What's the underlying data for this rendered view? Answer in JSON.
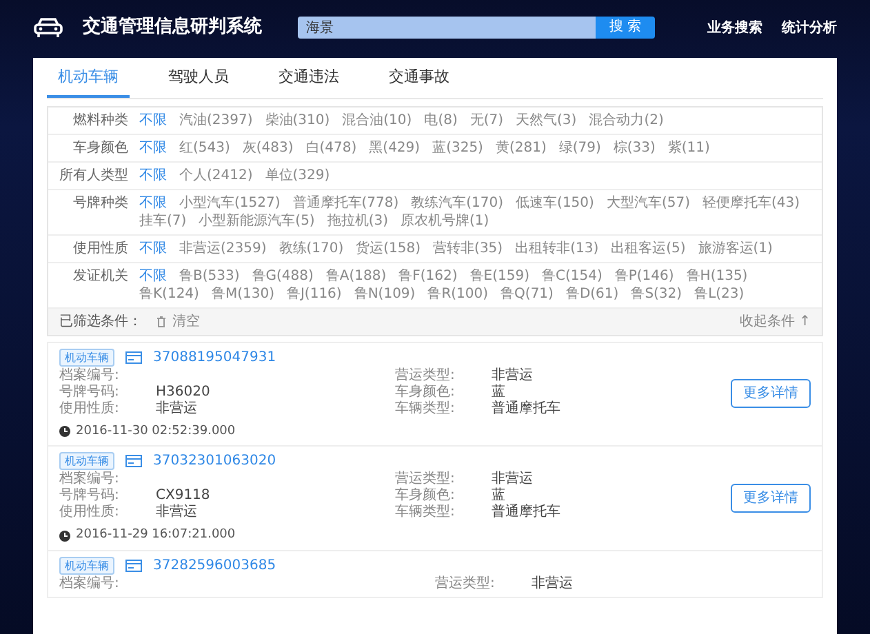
{
  "header": {
    "title": "交通管理信息研判系统",
    "search": {
      "value": "海景",
      "button": "搜 索"
    },
    "nav": [
      "业务搜索",
      "统计分析"
    ]
  },
  "tabs": [
    {
      "label": "机动车辆",
      "selected": true
    },
    {
      "label": "驾驶人员",
      "selected": false
    },
    {
      "label": "交通违法",
      "selected": false
    },
    {
      "label": "交通事故",
      "selected": false
    }
  ],
  "filters": [
    {
      "label": "燃料种类",
      "options": [
        {
          "text": "不限",
          "selected": true
        },
        {
          "text": "汽油(2397)",
          "selected": false
        },
        {
          "text": "柴油(310)",
          "selected": false
        },
        {
          "text": "混合油(10)",
          "selected": false
        },
        {
          "text": "电(8)",
          "selected": false
        },
        {
          "text": "无(7)",
          "selected": false
        },
        {
          "text": "天然气(3)",
          "selected": false
        },
        {
          "text": "混合动力(2)",
          "selected": false
        }
      ]
    },
    {
      "label": "车身颜色",
      "options": [
        {
          "text": "不限",
          "selected": true
        },
        {
          "text": "红(543)",
          "selected": false
        },
        {
          "text": "灰(483)",
          "selected": false
        },
        {
          "text": "白(478)",
          "selected": false
        },
        {
          "text": "黑(429)",
          "selected": false
        },
        {
          "text": "蓝(325)",
          "selected": false
        },
        {
          "text": "黄(281)",
          "selected": false
        },
        {
          "text": "绿(79)",
          "selected": false
        },
        {
          "text": "棕(33)",
          "selected": false
        },
        {
          "text": "紫(11)",
          "selected": false
        }
      ]
    },
    {
      "label": "所有人类型",
      "options": [
        {
          "text": "不限",
          "selected": true
        },
        {
          "text": "个人(2412)",
          "selected": false
        },
        {
          "text": "单位(329)",
          "selected": false
        }
      ]
    },
    {
      "label": "号牌种类",
      "options": [
        {
          "text": "不限",
          "selected": true
        },
        {
          "text": "小型汽车(1527)",
          "selected": false
        },
        {
          "text": "普通摩托车(778)",
          "selected": false
        },
        {
          "text": "教练汽车(170)",
          "selected": false
        },
        {
          "text": "低速车(150)",
          "selected": false
        },
        {
          "text": "大型汽车(57)",
          "selected": false
        },
        {
          "text": "轻便摩托车(43)",
          "selected": false
        },
        {
          "text": "挂车(7)",
          "selected": false
        },
        {
          "text": "小型新能源汽车(5)",
          "selected": false
        },
        {
          "text": "拖拉机(3)",
          "selected": false
        },
        {
          "text": "原农机号牌(1)",
          "selected": false
        }
      ]
    },
    {
      "label": "使用性质",
      "options": [
        {
          "text": "不限",
          "selected": true
        },
        {
          "text": "非营运(2359)",
          "selected": false
        },
        {
          "text": "教练(170)",
          "selected": false
        },
        {
          "text": "货运(158)",
          "selected": false
        },
        {
          "text": "营转非(35)",
          "selected": false
        },
        {
          "text": "出租转非(13)",
          "selected": false
        },
        {
          "text": "出租客运(5)",
          "selected": false
        },
        {
          "text": "旅游客运(1)",
          "selected": false
        }
      ]
    },
    {
      "label": "发证机关",
      "options": [
        {
          "text": "不限",
          "selected": true
        },
        {
          "text": "鲁B(533)",
          "selected": false
        },
        {
          "text": "鲁G(488)",
          "selected": false
        },
        {
          "text": "鲁A(188)",
          "selected": false
        },
        {
          "text": "鲁F(162)",
          "selected": false
        },
        {
          "text": "鲁E(159)",
          "selected": false
        },
        {
          "text": "鲁C(154)",
          "selected": false
        },
        {
          "text": "鲁P(146)",
          "selected": false
        },
        {
          "text": "鲁H(135)",
          "selected": false
        },
        {
          "text": "鲁K(124)",
          "selected": false
        },
        {
          "text": "鲁M(130)",
          "selected": false
        },
        {
          "text": "鲁J(116)",
          "selected": false
        },
        {
          "text": "鲁N(109)",
          "selected": false
        },
        {
          "text": "鲁R(100)",
          "selected": false
        },
        {
          "text": "鲁Q(71)",
          "selected": false
        },
        {
          "text": "鲁D(61)",
          "selected": false
        },
        {
          "text": "鲁S(32)",
          "selected": false
        },
        {
          "text": "鲁L(23)",
          "selected": false
        }
      ]
    }
  ],
  "selected_bar": {
    "label": "已筛选条件：",
    "clear": "清空",
    "collapse": "收起条件 ↑"
  },
  "records": [
    {
      "tag": "机动车辆",
      "id": "37088195047931",
      "left": [
        [
          "档案编号:"
        ],
        [
          "号牌号码:",
          "H36020"
        ],
        [
          "使用性质:",
          "非营运"
        ]
      ],
      "right": [
        [
          "营运类型:",
          "非营运"
        ],
        [
          "车身颜色:",
          "蓝"
        ],
        [
          "车辆类型:",
          "普通摩托车"
        ]
      ],
      "time": "2016-11-30 02:52:39.000",
      "button": "更多详情"
    },
    {
      "tag": "机动车辆",
      "id": "37032301063020",
      "left": [
        [
          "档案编号:"
        ],
        [
          "号牌号码:",
          "CX9118"
        ],
        [
          "使用性质:",
          "非营运"
        ]
      ],
      "right": [
        [
          "营运类型:",
          "非营运"
        ],
        [
          "车身颜色:",
          "蓝"
        ],
        [
          "车辆类型:",
          "普通摩托车"
        ]
      ],
      "time": "2016-11-29 16:07:21.000",
      "button": "更多详情"
    },
    {
      "tag": "机动车辆",
      "id": "37282596003685",
      "left": [
        [
          "档案编号:"
        ]
      ],
      "right": [
        [
          "营运类型:",
          "非营运"
        ]
      ]
    }
  ]
}
